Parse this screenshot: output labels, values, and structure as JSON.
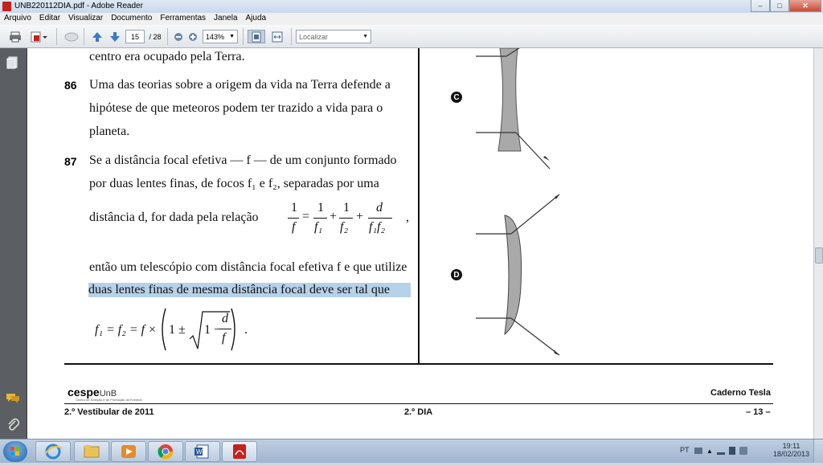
{
  "window": {
    "title": "UNB220112DIA.pdf - Adobe Reader",
    "minimize": "–",
    "maximize": "□",
    "close": "✕"
  },
  "menu": [
    "Arquivo",
    "Editar",
    "Visualizar",
    "Documento",
    "Ferramentas",
    "Janela",
    "Ajuda"
  ],
  "toolbar": {
    "page_current": "15",
    "page_total": "/ 28",
    "zoom": "143%",
    "find_placeholder": "Localizar"
  },
  "page": {
    "top_line": "centro era ocupado pela Terra.",
    "q86": {
      "num": "86",
      "lines": [
        "Uma das teorias sobre a origem da vida na Terra defende a",
        "hipótese de que meteoros podem ter trazido a vida para o",
        "planeta."
      ]
    },
    "q87": {
      "num": "87",
      "line1": "Se a distância focal efetiva — f — de um conjunto formado",
      "line2": "por duas lentes finas, de focos f₁ e f₂, separadas por uma",
      "line3": "distância d, for dada pela relação",
      "line4": "então um telescópio com distância focal efetiva f e que utilize",
      "line5": "duas lentes finas de mesma distância focal deve ser tal que",
      "formula1": {
        "lhs_num": "1",
        "lhs_den": "f",
        "t1_num": "1",
        "t1_den": "f₁",
        "t2_num": "1",
        "t2_den": "f₂",
        "t3_num": "d",
        "t3_den": "f₁f₂",
        "comma": ","
      },
      "formula2": {
        "lhs": "f₁ = f₂ = f ×",
        "inside": "1 ±",
        "root_lead": "1 −",
        "frac_num": "d",
        "frac_den": "f",
        "period": "."
      }
    },
    "labels": {
      "c": "C",
      "d": "D"
    },
    "footer": {
      "logo": "cespe",
      "logo_suffix": "UnB",
      "logo_sub": "Centro de Seleção e de Promoção de Eventos",
      "right_title": "Caderno Tesla",
      "left": "2.º Vestibular de 2011",
      "center": "2.º DIA",
      "page": "– 13 –"
    }
  },
  "taskbar": {
    "lang": "PT",
    "time": "19:11",
    "date": "18/02/2013"
  },
  "colors": {
    "highlight": "#b6d1ea",
    "lens": "#a9a9a9",
    "titlebar": "#c9d9ec"
  }
}
